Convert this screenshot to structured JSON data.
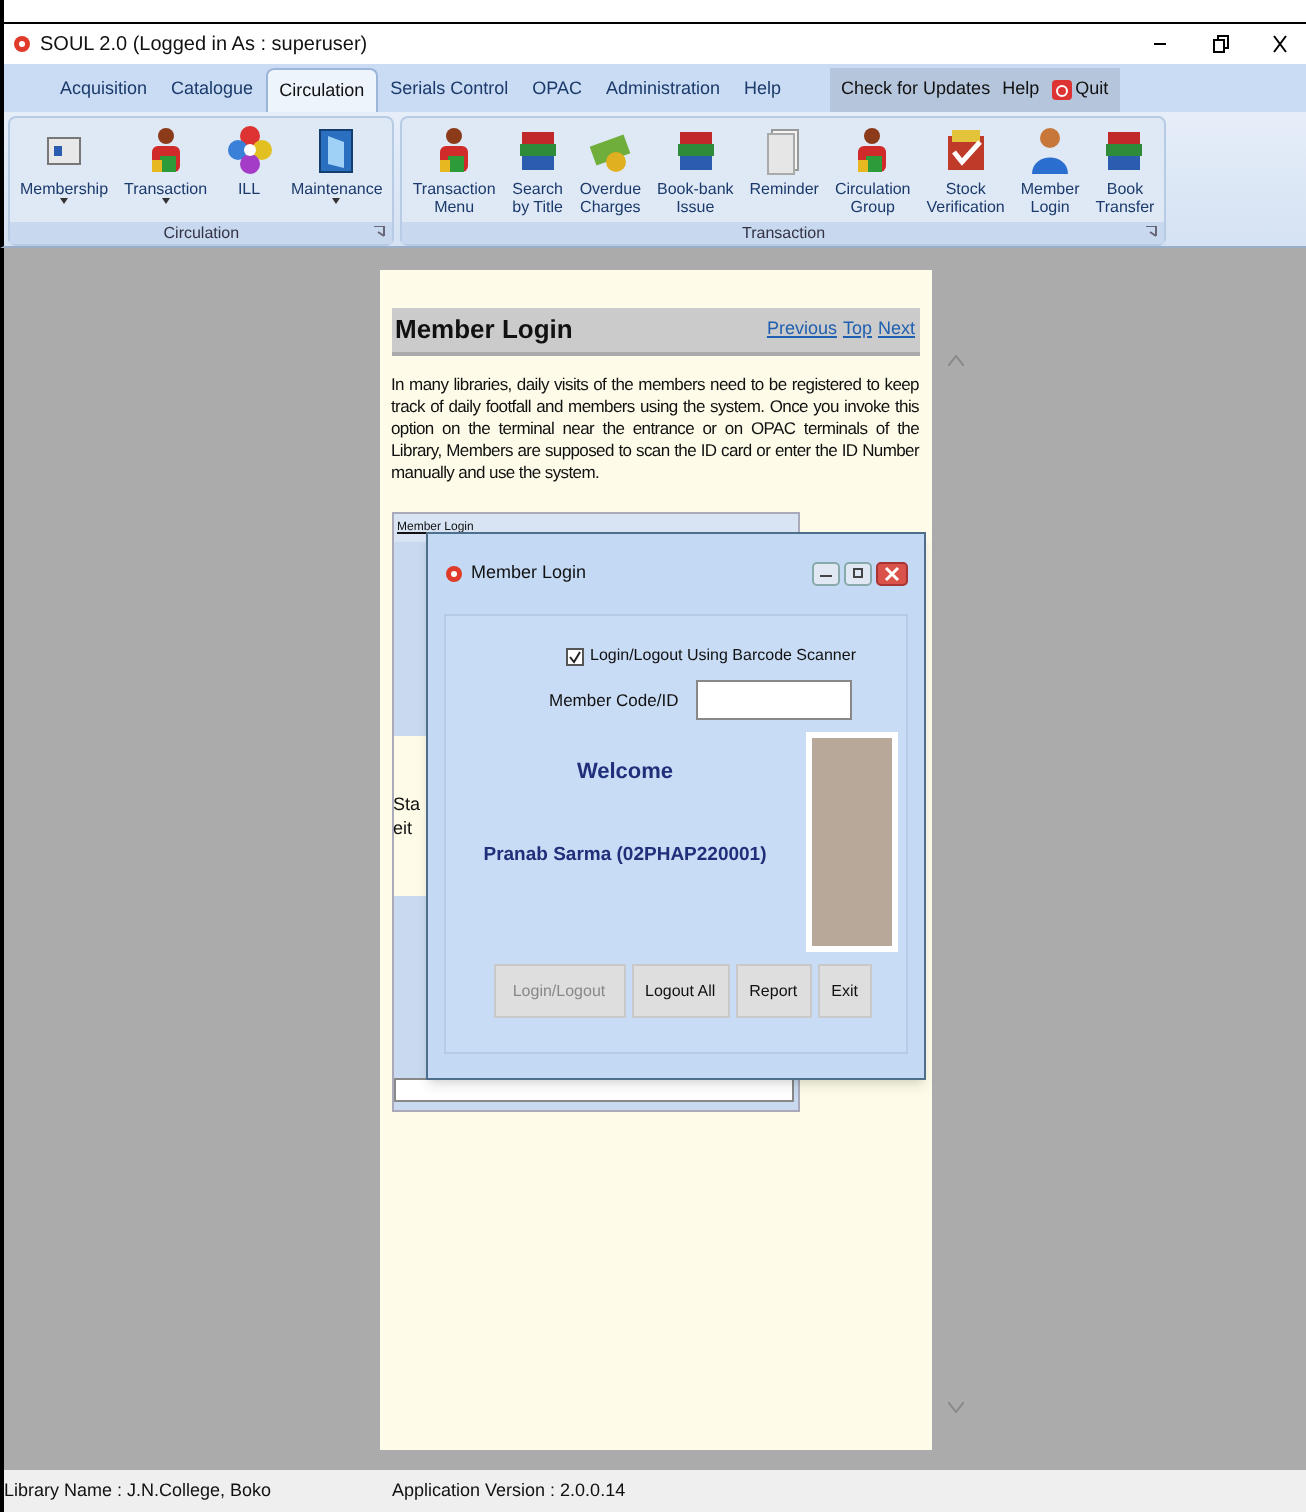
{
  "window": {
    "title": "SOUL 2.0 (Logged in As : superuser)"
  },
  "menu_tabs": [
    {
      "label": "Acquisition",
      "selected": false
    },
    {
      "label": "Catalogue",
      "selected": false
    },
    {
      "label": "Circulation",
      "selected": true
    },
    {
      "label": "Serials Control",
      "selected": false
    },
    {
      "label": "OPAC",
      "selected": false
    },
    {
      "label": "Administration",
      "selected": false
    },
    {
      "label": "Help",
      "selected": false
    }
  ],
  "menu_extra": [
    {
      "label": "Check for Updates",
      "kind": "text"
    },
    {
      "label": "Help",
      "kind": "text"
    },
    {
      "label": "Quit",
      "kind": "quit"
    }
  ],
  "ribbon_groups": [
    {
      "label": "Circulation",
      "items": [
        {
          "label": "Membership",
          "dropdown": true
        },
        {
          "label": "Transaction",
          "dropdown": true
        },
        {
          "label": "ILL",
          "dropdown": false
        },
        {
          "label": "Maintenance",
          "dropdown": true
        }
      ]
    },
    {
      "label": "Transaction",
      "items": [
        {
          "label": "Transaction\nMenu",
          "dropdown": false
        },
        {
          "label": "Search\nby Title",
          "dropdown": false
        },
        {
          "label": "Overdue\nCharges",
          "dropdown": false
        },
        {
          "label": "Book-bank\nIssue",
          "dropdown": false
        },
        {
          "label": "Reminder",
          "dropdown": false
        },
        {
          "label": "Circulation\nGroup",
          "dropdown": false
        },
        {
          "label": "Stock\nVerification",
          "dropdown": false
        },
        {
          "label": "Member\nLogin",
          "dropdown": false
        },
        {
          "label": "Book\nTransfer",
          "dropdown": false
        }
      ]
    }
  ],
  "document": {
    "title": "Member Login",
    "links": [
      "Previous",
      "Top",
      "Next"
    ],
    "paragraph": "In many libraries, daily visits of the members need to be registered to keep track of daily footfall and members using the system.  Once you invoke this option on the terminal near the entrance or on OPAC terminals of the Library, Members are supposed to scan the ID card or enter the ID Number manually and use the system.",
    "background_window": {
      "title": "Member Login",
      "fragments": [
        "Sta",
        "eit"
      ]
    },
    "dialog": {
      "title": "Member Login",
      "checkbox": {
        "label": "Login/Logout Using Barcode Scanner",
        "checked": true
      },
      "field": {
        "label": "Member Code/ID"
      },
      "welcome": "Welcome",
      "member": "Pranab Sarma (02PHAP220001)",
      "buttons": [
        {
          "label": "Login/Logout",
          "disabled": true
        },
        {
          "label": "Logout All",
          "disabled": false
        },
        {
          "label": "Report",
          "disabled": false
        },
        {
          "label": "Exit",
          "disabled": false
        }
      ]
    }
  },
  "status_bar": {
    "library": "Library Name : J.N.College, Boko",
    "version": "Application Version : 2.0.0.14"
  }
}
